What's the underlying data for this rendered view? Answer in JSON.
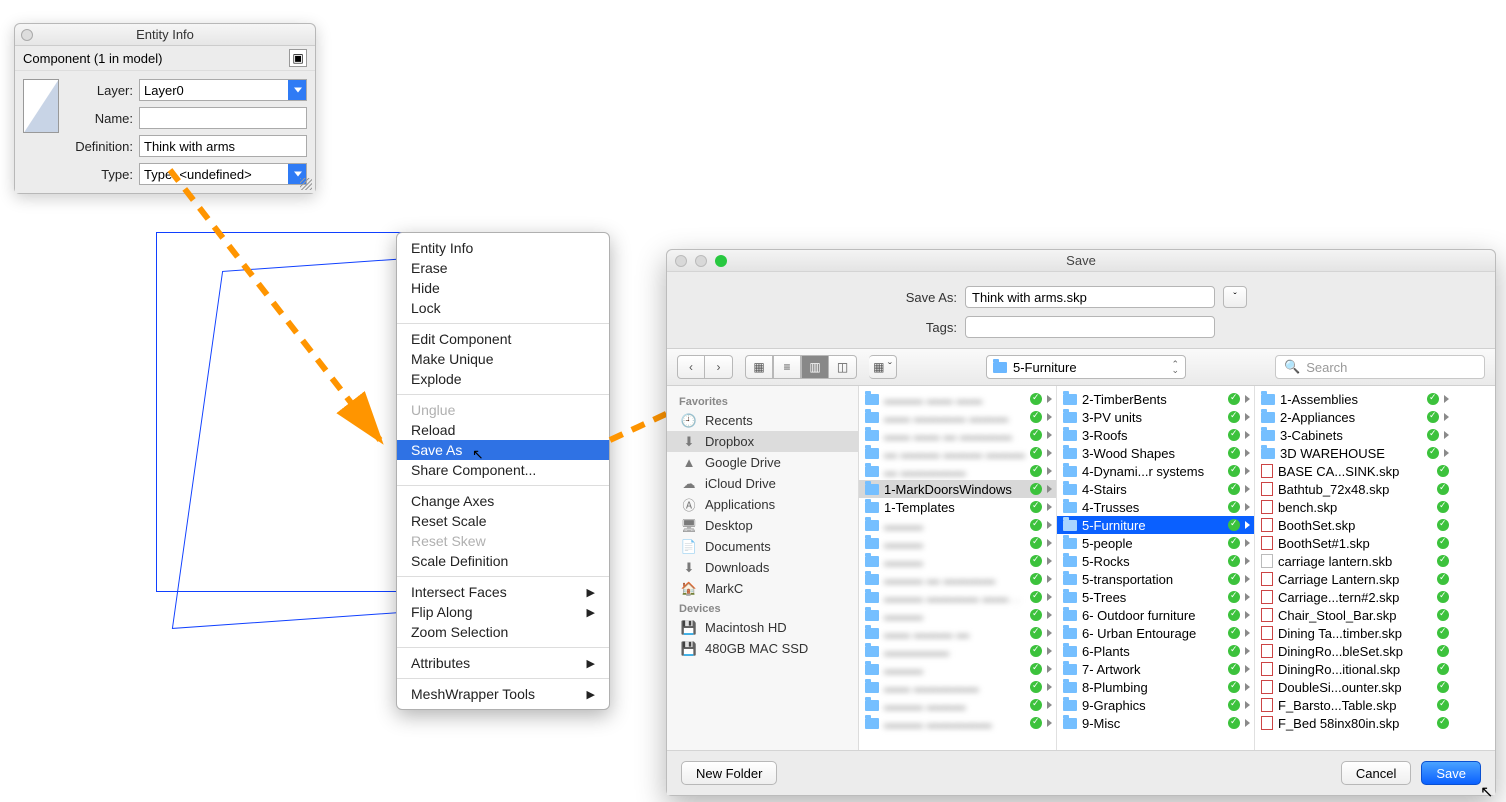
{
  "entity_info": {
    "title": "Entity Info",
    "subtitle": "Component (1 in model)",
    "fields": {
      "layer_label": "Layer:",
      "layer_value": "Layer0",
      "name_label": "Name:",
      "name_value": "",
      "definition_label": "Definition:",
      "definition_value": "Think with arms",
      "type_label": "Type:",
      "type_value": "Type: <undefined>"
    }
  },
  "context_menu": {
    "groups": [
      [
        "Entity Info",
        "Erase",
        "Hide",
        "Lock"
      ],
      [
        "Edit Component",
        "Make Unique",
        "Explode"
      ],
      [
        "Unglue",
        "Reload",
        "Save As",
        "Share Component..."
      ],
      [
        "Change Axes",
        "Reset Scale",
        "Reset Skew",
        "Scale Definition"
      ],
      [
        "Intersect Faces",
        "Flip Along",
        "Zoom Selection"
      ],
      [
        "Attributes"
      ],
      [
        "MeshWrapper Tools"
      ]
    ],
    "disabled": [
      "Unglue",
      "Reset Skew"
    ],
    "highlighted": "Save As",
    "submenus": [
      "Intersect Faces",
      "Flip Along",
      "Attributes",
      "MeshWrapper Tools"
    ]
  },
  "save_dialog": {
    "title": "Save",
    "save_as_label": "Save As:",
    "save_as_value": "Think with arms.skp",
    "tags_label": "Tags:",
    "tags_value": "",
    "location_value": "5-Furniture",
    "search_placeholder": "Search",
    "sidebar": {
      "favorites_header": "Favorites",
      "favorites": [
        "Recents",
        "Dropbox",
        "Google Drive",
        "iCloud Drive",
        "Applications",
        "Desktop",
        "Documents",
        "Downloads",
        "MarkC"
      ],
      "devices_header": "Devices",
      "devices": [
        "Macintosh HD",
        "480GB MAC SSD"
      ],
      "active": "Dropbox"
    },
    "columns": [
      {
        "blurred": true,
        "items": [
          "▬▬▬ ▬▬ ▬▬",
          "▬▬ ▬▬▬▬ ▬▬▬",
          "▬▬ ▬▬ ▬ ▬▬▬▬",
          "▬ ▬▬▬ ▬▬▬ ▬▬▬",
          "▬ ▬▬▬▬▬",
          "1-MarkDoorsWindows",
          "1-Templates",
          "▬▬▬",
          "▬▬▬",
          "▬▬▬",
          "▬▬▬ ▬ ▬▬▬▬",
          "▬▬▬ ▬▬▬▬ ▬▬▬▬ ▬",
          "▬▬▬",
          "▬▬ ▬▬▬ ▬",
          "▬▬▬▬▬",
          "▬▬▬",
          "▬▬ ▬▬▬▬▬",
          "▬▬▬ ▬▬▬",
          "▬▬▬ ▬▬▬▬▬"
        ],
        "selected": "1-MarkDoorsWindows"
      },
      {
        "items": [
          "2-TimberBents",
          "3-PV units",
          "3-Roofs",
          "3-Wood Shapes",
          "4-Dynami...r systems",
          "4-Stairs",
          "4-Trusses",
          "5-Furniture",
          "5-people",
          "5-Rocks",
          "5-transportation",
          "5-Trees",
          "6- Outdoor furniture",
          "6- Urban Entourage",
          "6-Plants",
          "7- Artwork",
          "8-Plumbing",
          "9-Graphics",
          "9-Misc"
        ],
        "highlighted": "5-Furniture"
      },
      {
        "items": [
          {
            "name": "1-Assemblies",
            "type": "folder"
          },
          {
            "name": "2-Appliances",
            "type": "folder"
          },
          {
            "name": "3-Cabinets",
            "type": "folder"
          },
          {
            "name": "3D WAREHOUSE",
            "type": "folder"
          },
          {
            "name": "BASE CA...SINK.skp",
            "type": "skp"
          },
          {
            "name": "Bathtub_72x48.skp",
            "type": "skp"
          },
          {
            "name": "bench.skp",
            "type": "skp"
          },
          {
            "name": "BoothSet.skp",
            "type": "skp"
          },
          {
            "name": "BoothSet#1.skp",
            "type": "skp"
          },
          {
            "name": "carriage lantern.skb",
            "type": "grey"
          },
          {
            "name": "Carriage Lantern.skp",
            "type": "skp"
          },
          {
            "name": "Carriage...tern#2.skp",
            "type": "skp"
          },
          {
            "name": "Chair_Stool_Bar.skp",
            "type": "skp"
          },
          {
            "name": "Dining Ta...timber.skp",
            "type": "skp"
          },
          {
            "name": "DiningRo...bleSet.skp",
            "type": "skp"
          },
          {
            "name": "DiningRo...itional.skp",
            "type": "skp"
          },
          {
            "name": "DoubleSi...ounter.skp",
            "type": "skp"
          },
          {
            "name": "F_Barsto...Table.skp",
            "type": "skp"
          },
          {
            "name": "F_Bed 58inx80in.skp",
            "type": "skp"
          }
        ]
      }
    ],
    "footer": {
      "new_folder": "New Folder",
      "cancel": "Cancel",
      "save": "Save"
    }
  }
}
